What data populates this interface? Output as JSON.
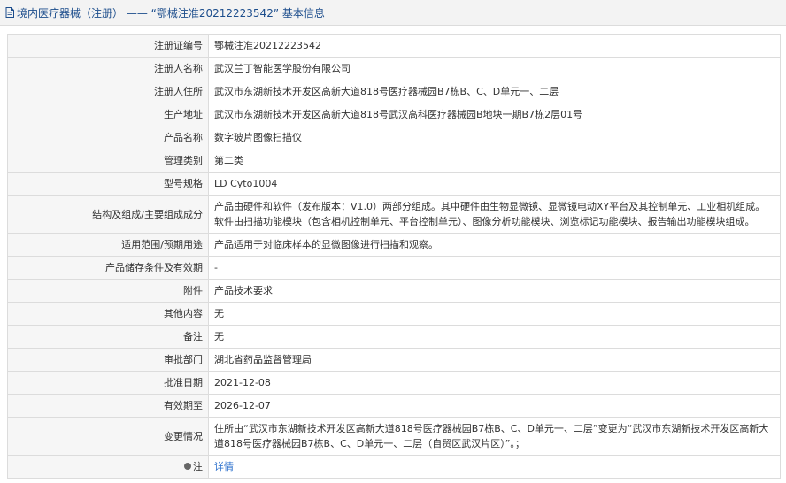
{
  "header": {
    "title": "境内医疗器械（注册） —— “鄂械注准20212223542” 基本信息",
    "icon": "document-icon"
  },
  "rows": [
    {
      "label": "注册证编号",
      "value": "鄂械注准20212223542"
    },
    {
      "label": "注册人名称",
      "value": "武汉兰丁智能医学股份有限公司"
    },
    {
      "label": "注册人住所",
      "value": "武汉市东湖新技术开发区高新大道818号医疗器械园B7栋B、C、D单元一、二层"
    },
    {
      "label": "生产地址",
      "value": "武汉市东湖新技术开发区高新大道818号武汉高科医疗器械园B地块一期B7栋2层01号"
    },
    {
      "label": "产品名称",
      "value": "数字玻片图像扫描仪"
    },
    {
      "label": "管理类别",
      "value": "第二类"
    },
    {
      "label": "型号规格",
      "value": "LD Cyto1004"
    },
    {
      "label": "结构及组成/主要组成成分",
      "value": "产品由硬件和软件（发布版本：V1.0）两部分组成。其中硬件由生物显微镜、显微镜电动XY平台及其控制单元、工业相机组成。软件由扫描功能模块（包含相机控制单元、平台控制单元）、图像分析功能模块、浏览标记功能模块、报告输出功能模块组成。"
    },
    {
      "label": "适用范围/预期用途",
      "value": "产品适用于对临床样本的显微图像进行扫描和观察。"
    },
    {
      "label": "产品储存条件及有效期",
      "value": "-"
    },
    {
      "label": "附件",
      "value": "产品技术要求"
    },
    {
      "label": "其他内容",
      "value": "无"
    },
    {
      "label": "备注",
      "value": "无"
    },
    {
      "label": "审批部门",
      "value": "湖北省药品监督管理局"
    },
    {
      "label": "批准日期",
      "value": "2021-12-08"
    },
    {
      "label": "有效期至",
      "value": "2026-12-07"
    },
    {
      "label": "变更情况",
      "value": "住所由“武汉市东湖新技术开发区高新大道818号医疗器械园B7栋B、C、D单元一、二层”变更为“武汉市东湖新技术开发区高新大道818号医疗器械园B7栋B、C、D单元一、二层（自贸区武汉片区）”。；"
    }
  ],
  "note": {
    "label": "注",
    "icon": "location-pin-icon",
    "link_text": "详情"
  },
  "colors": {
    "accent": "#1c4d8c",
    "link": "#2a6fcc",
    "label_bg": "#f6f6f6",
    "border": "#dcdcdc"
  }
}
